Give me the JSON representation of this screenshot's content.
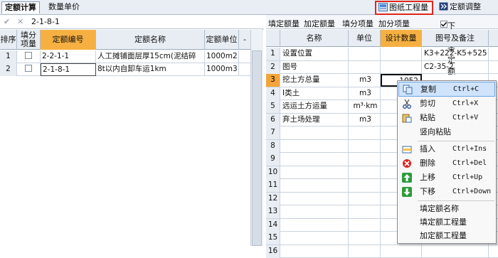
{
  "top_tabs": {
    "calc": "定额计算",
    "unit_price": "数量单价",
    "drawing_qty": "图纸工程量",
    "adjust": "定额调整"
  },
  "edit_bar": {
    "value": "2-1-8-1"
  },
  "left_table": {
    "headers": {
      "seq": "排序",
      "fill": "填分项量",
      "code": "定额编号",
      "name": "定额名称",
      "unit": "定额单位"
    },
    "rows": [
      {
        "seq": "1",
        "code": "2-2-1-1",
        "name": "人工摊铺面层厚15cm(泥结碎",
        "unit": "1000m2"
      },
      {
        "seq": "2",
        "code": "2-1-8-1",
        "name": "8t以内自卸车运1km",
        "unit": "1000m3"
      }
    ]
  },
  "right_toolbar": {
    "fill_qty": "填定额量",
    "add_qty": "加定额量",
    "fill_sub": "填分项量",
    "add_sub": "加分项量",
    "next_label": "下一条定额"
  },
  "right_table": {
    "headers": {
      "name": "名称",
      "unit": "单位",
      "design": "设计数量",
      "ref": "图号及备注"
    },
    "rows": [
      {
        "n": "1",
        "name": "设置位置",
        "unit": "",
        "design": "",
        "ref": "K3+222-K5+525"
      },
      {
        "n": "2",
        "name": "图号",
        "unit": "",
        "design": "",
        "ref": "C2-35-2"
      },
      {
        "n": "3",
        "name": "挖土方总量",
        "unit": "m3",
        "design": "1052",
        "ref": ""
      },
      {
        "n": "4",
        "name": "I类土",
        "unit": "m3",
        "design": "",
        "ref": ""
      },
      {
        "n": "5",
        "name": "远运土方运量",
        "unit": "m³·km",
        "design": "",
        "ref": ""
      },
      {
        "n": "6",
        "name": "弃土场处理",
        "unit": "m3",
        "design": "",
        "ref": ""
      },
      {
        "n": "7"
      },
      {
        "n": "8"
      },
      {
        "n": "9"
      },
      {
        "n": "10"
      },
      {
        "n": "11"
      },
      {
        "n": "12"
      },
      {
        "n": "13"
      },
      {
        "n": "14"
      },
      {
        "n": "15"
      },
      {
        "n": "16"
      }
    ]
  },
  "context_menu": {
    "copy": "复制",
    "copy_sc": "Ctrl+C",
    "cut": "剪切",
    "cut_sc": "Ctrl+X",
    "paste": "粘贴",
    "paste_sc": "Ctrl+V",
    "vpaste": "竖向粘贴",
    "insert": "插入",
    "insert_sc": "Ctrl+Ins",
    "delete": "删除",
    "delete_sc": "Ctrl+Del",
    "up": "上移",
    "up_sc": "Ctrl+Up",
    "down": "下移",
    "down_sc": "Ctrl+Down",
    "fill_name": "填定额名称",
    "fill_qty": "填定额工程量",
    "add_qty": "加定额工程量"
  },
  "colors": {
    "accent": "#f4a53a",
    "highlight_border": "#e0261c",
    "menu_hover": "#cfe3fb"
  }
}
